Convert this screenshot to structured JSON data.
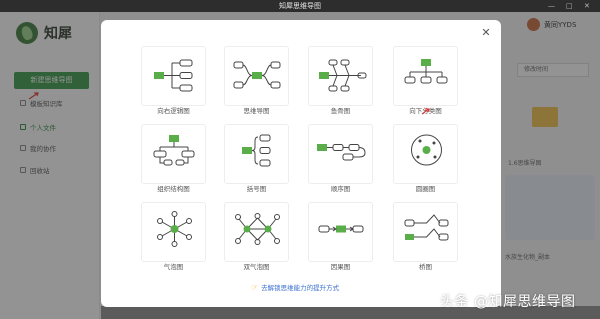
{
  "titlebar": {
    "title": "知犀思维导图",
    "controls": [
      "—",
      "□",
      "✕"
    ]
  },
  "sidebar": {
    "logo_text": "知犀",
    "new_button": "新建思维导图",
    "items": [
      {
        "label": "模板知识库",
        "icon": "template-icon"
      },
      {
        "label": "个人文件",
        "icon": "folder-icon",
        "active": true
      },
      {
        "label": "我的协作",
        "icon": "team-icon"
      },
      {
        "label": "回收站",
        "icon": "trash-icon"
      }
    ]
  },
  "header": {
    "username": "黄同YYDS",
    "sort_label": "修改时间"
  },
  "background": {
    "file1": "1.6思维导图",
    "file2": "水族生化物_副本"
  },
  "modal": {
    "templates": [
      {
        "label": "向右逻辑图",
        "icon": "logic-right-icon"
      },
      {
        "label": "思维导图",
        "icon": "mindmap-icon"
      },
      {
        "label": "鱼骨图",
        "icon": "fishbone-icon"
      },
      {
        "label": "向下分类图",
        "icon": "classification-down-icon"
      },
      {
        "label": "组织结构图",
        "icon": "org-chart-icon"
      },
      {
        "label": "括号图",
        "icon": "bracket-icon"
      },
      {
        "label": "顺序图",
        "icon": "sequence-icon"
      },
      {
        "label": "圆圈图",
        "icon": "circle-map-icon"
      },
      {
        "label": "气泡图",
        "icon": "bubble-icon"
      },
      {
        "label": "双气泡图",
        "icon": "double-bubble-icon"
      },
      {
        "label": "因果图",
        "icon": "cause-effect-icon"
      },
      {
        "label": "桥图",
        "icon": "bridge-icon"
      }
    ],
    "promo_text": "去解锁思维能力的提升方式"
  },
  "watermark": "头条 @知犀思维导图",
  "colors": {
    "accent": "#3a9a4a",
    "node": "#5aae4a"
  }
}
